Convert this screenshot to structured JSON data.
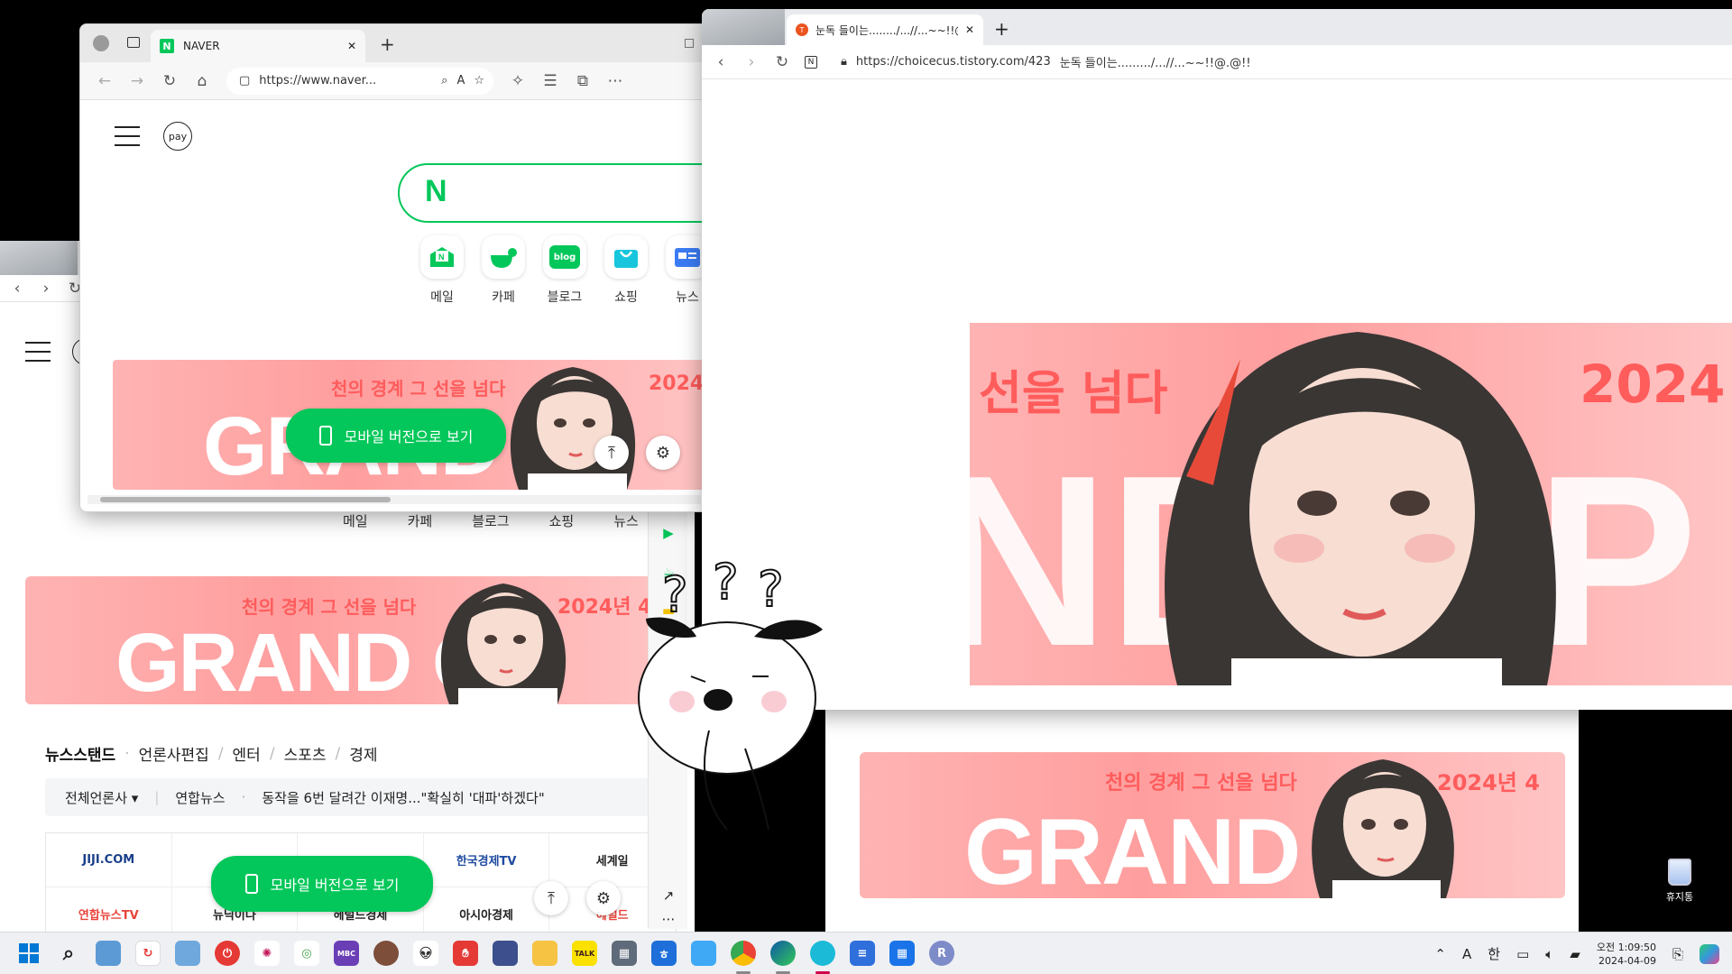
{
  "naver_window": {
    "tab_title": "NAVER",
    "url": "https://www.naver...",
    "pay_label": "pay",
    "search_logo": "N",
    "services": [
      {
        "label": "메일",
        "icon": "mail-icon"
      },
      {
        "label": "카페",
        "icon": "cafe-icon"
      },
      {
        "label": "블로그",
        "icon": "blog-icon"
      },
      {
        "label": "쇼핑",
        "icon": "shopping-icon"
      },
      {
        "label": "뉴스",
        "icon": "news-icon"
      }
    ],
    "blog_icon_text": "blog",
    "mobile_button": "모바일 버전으로 보기"
  },
  "banner": {
    "title": "천의 경계 그 선을 넘다",
    "year": "2024년 4",
    "year_short": "2024!",
    "big_text": "GRAND OPEN",
    "big_text_back": "GRAND OP",
    "big_text_front": "GRAND",
    "tistory_title": "선을 넘다",
    "tistory_big": "ND OP"
  },
  "back_window": {
    "categories": [
      "메일",
      "카페",
      "블로그",
      "쇼핑",
      "뉴스"
    ],
    "newsstand": {
      "active": "뉴스스탠드",
      "tabs": [
        "언론사편집",
        "엔터",
        "스포츠",
        "경제"
      ]
    },
    "press_selector": "전체언론사 ▾",
    "headline_source": "연합뉴스",
    "headline": "동작을 6번 달려간 이재명...\"확실히 '대파'하겠다\"",
    "press_logos": [
      "JIJI.COM",
      "",
      "",
      "한국경제TV",
      "세계일"
    ],
    "press_logos_row2": [
      "연합뉴스TV",
      "뉴닉이다",
      "헤럴드경제",
      "아시아경제",
      "헤럴드"
    ],
    "mobile_button": "모바일 버전으로 보기"
  },
  "tistory_window": {
    "tab_title": "눈독 들이는......../...//...~~!!@",
    "url": "https://choicecus.tistory.com/423",
    "page_title": "눈독 들이는........./...//...~~!!@.@!!"
  },
  "desktop": {
    "recycle_bin": "휴지통"
  },
  "taskbar": {
    "tray": {
      "ime_a": "A",
      "ime_han": "한",
      "time": "오전 1:09:50",
      "date": "2024-04-09"
    }
  },
  "colors": {
    "naver_green": "#03c75a",
    "banner_pink": "#ff9e9e",
    "banner_red": "#ff5c5c",
    "taskbar_bg": "#eef0f3"
  }
}
